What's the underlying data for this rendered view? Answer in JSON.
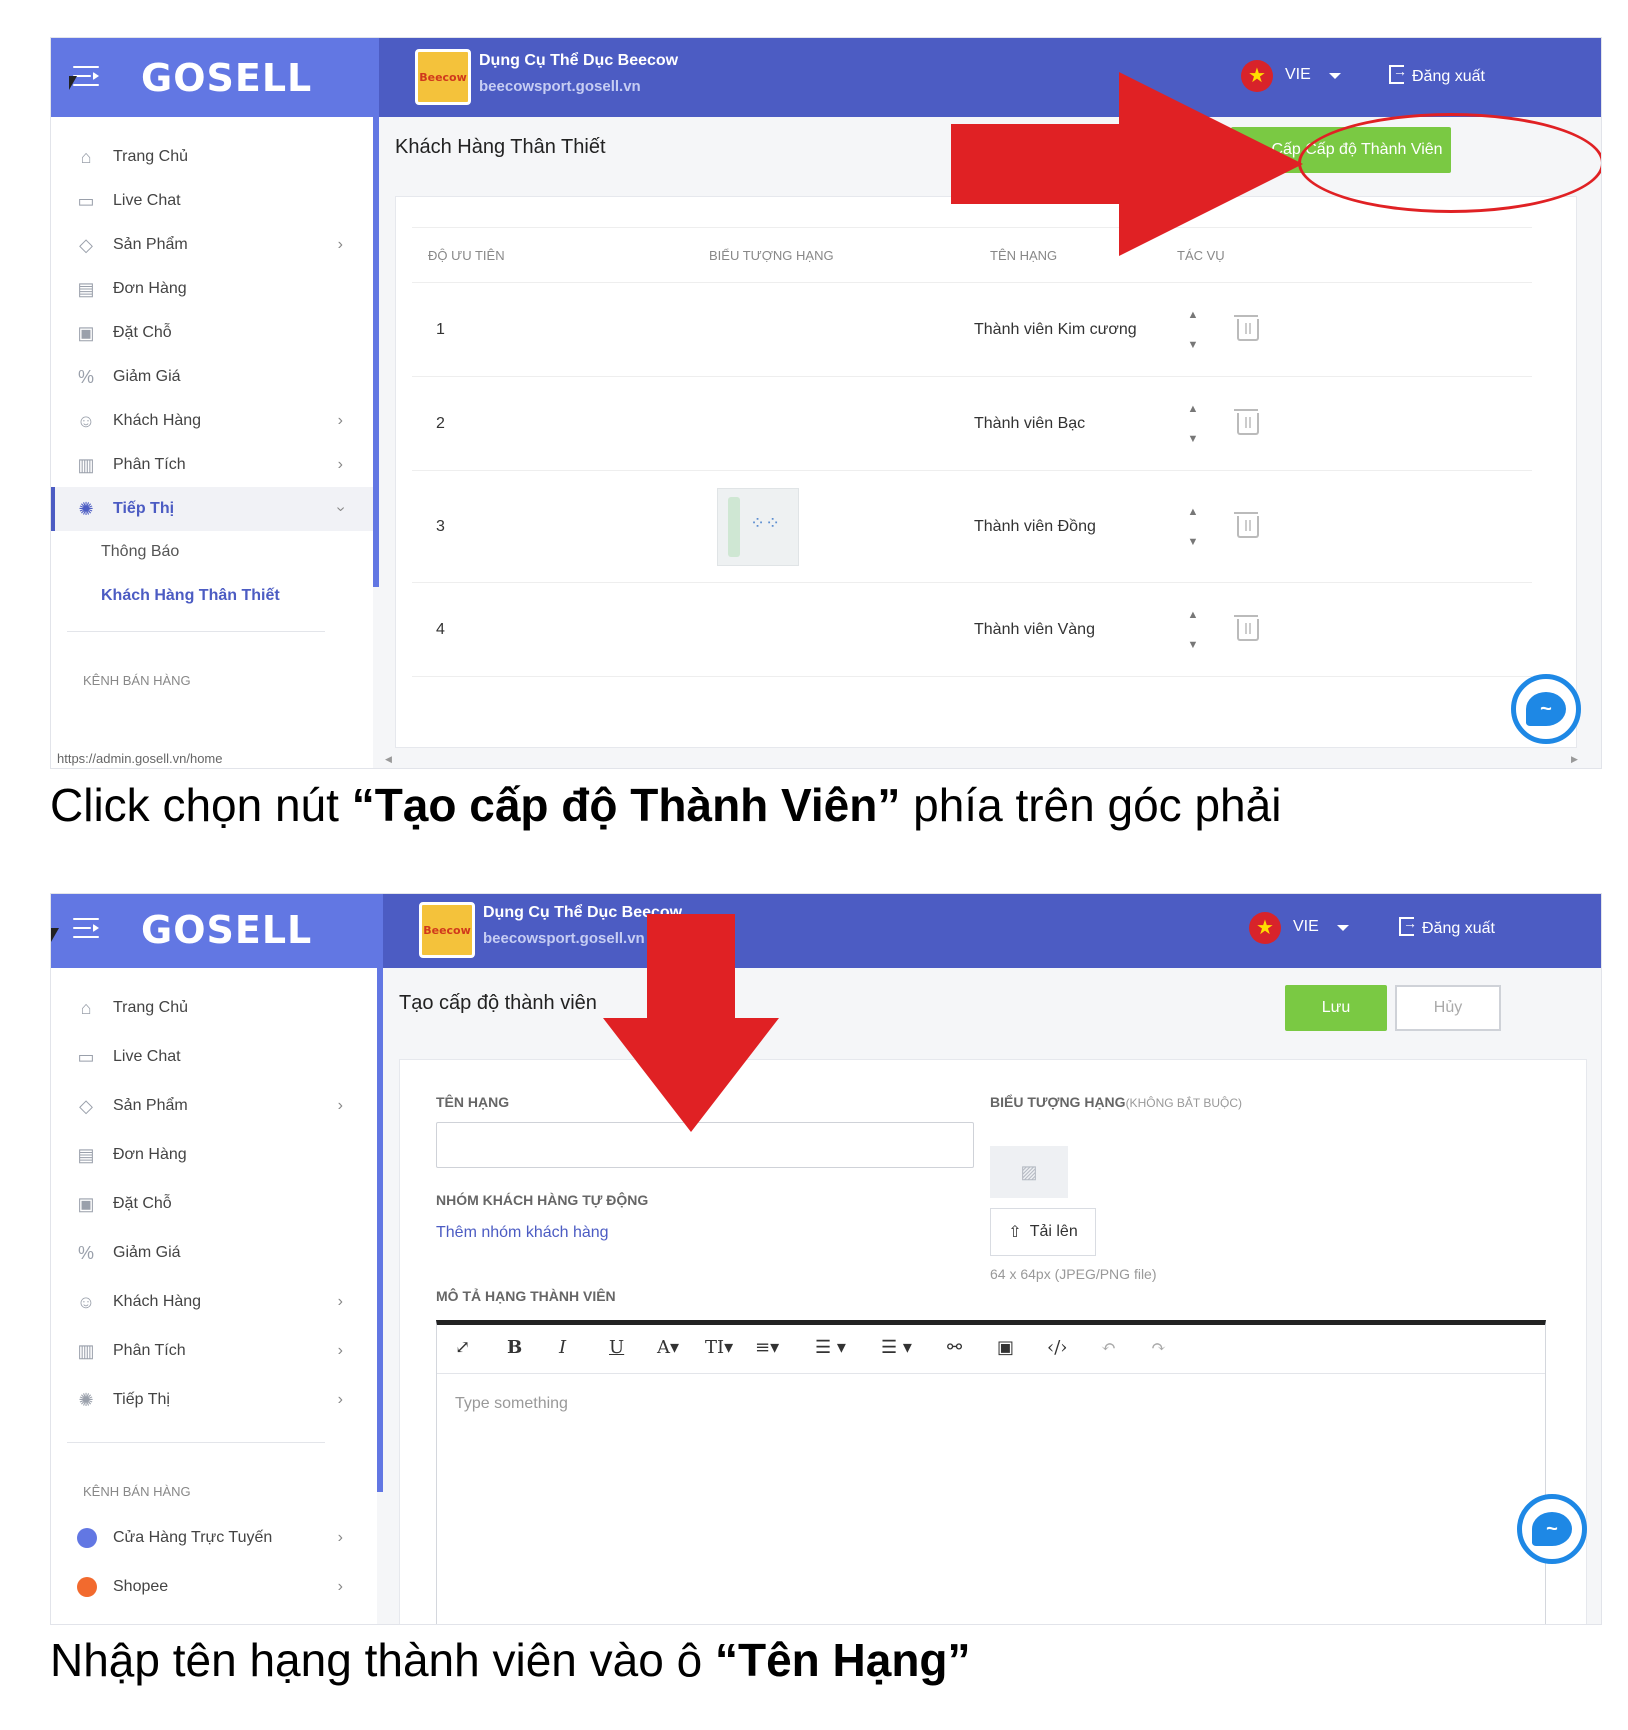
{
  "screens": [
    {
      "header": {
        "logo": "GOSELL",
        "store_logo_text": "Beecow",
        "store_name": "Dụng Cụ Thể Dục Beecow",
        "store_url": "beecowsport.gosell.vn",
        "language": "VIE",
        "logout": "Đăng xuất"
      },
      "sidebar": {
        "items": [
          {
            "label": "Trang Chủ"
          },
          {
            "label": "Live Chat"
          },
          {
            "label": "Sản Phẩm"
          },
          {
            "label": "Đơn Hàng"
          },
          {
            "label": "Đặt Chỗ"
          },
          {
            "label": "Giảm Giá"
          },
          {
            "label": "Khách Hàng"
          },
          {
            "label": "Phân Tích"
          },
          {
            "label": "Tiếp Thị"
          }
        ],
        "sub_items": [
          {
            "label": "Thông Báo"
          },
          {
            "label": "Khách Hàng Thân Thiết"
          }
        ],
        "channel_title": "KÊNH BÁN HÀNG",
        "status_url": "https://admin.gosell.vn/home"
      },
      "main": {
        "title": "Khách Hàng Thân Thiết",
        "create_button": "Tạo Cấp Cấp độ Thành Viên",
        "columns": [
          "ĐỘ ƯU TIÊN",
          "BIỂU TƯỢNG HẠNG",
          "TÊN HẠNG",
          "TÁC VỤ"
        ],
        "rows": [
          {
            "priority": "1",
            "name": "Thành viên Kim cương",
            "has_icon": false
          },
          {
            "priority": "2",
            "name": "Thành viên Bạc",
            "has_icon": false
          },
          {
            "priority": "3",
            "name": "Thành viên Đồng",
            "has_icon": true
          },
          {
            "priority": "4",
            "name": "Thành viên Vàng",
            "has_icon": false
          }
        ]
      },
      "caption": {
        "before": "Click chọn nút ",
        "bold": "“Tạo cấp độ Thành Viên”",
        "after": " phía trên góc phải"
      }
    },
    {
      "header": {
        "logo": "GOSELL",
        "store_logo_text": "Beecow",
        "store_name": "Dụng Cụ Thể Dục Beecow",
        "store_url": "beecowsport.gosell.vn",
        "language": "VIE",
        "logout": "Đăng xuất"
      },
      "sidebar": {
        "items": [
          {
            "label": "Trang Chủ"
          },
          {
            "label": "Live Chat"
          },
          {
            "label": "Sản Phẩm"
          },
          {
            "label": "Đơn Hàng"
          },
          {
            "label": "Đặt Chỗ"
          },
          {
            "label": "Giảm Giá"
          },
          {
            "label": "Khách Hàng"
          },
          {
            "label": "Phân Tích"
          },
          {
            "label": "Tiếp Thị"
          }
        ],
        "channel_title": "KÊNH BÁN HÀNG",
        "channels": [
          {
            "label": "Cửa Hàng Trực Tuyến"
          },
          {
            "label": "Shopee"
          }
        ]
      },
      "main": {
        "title": "Tạo cấp độ thành viên",
        "save_button": "Lưu",
        "cancel_button": "Hủy",
        "tier_name_label": "TÊN HẠNG",
        "tier_name_value": "",
        "tier_icon_label": "BIỂU TƯỢNG HẠNG",
        "tier_icon_optional": "(KHÔNG BẮT BUỘC)",
        "auto_group_label": "NHÓM KHÁCH HÀNG TỰ ĐỘNG",
        "add_group_link": "Thêm nhóm khách hàng",
        "upload_button": "Tải lên",
        "upload_hint": "64 x 64px (JPEG/PNG file)",
        "description_label": "MÔ TẢ HẠNG THÀNH VIÊN",
        "editor_placeholder": "Type something"
      },
      "caption": {
        "before": "Nhập tên hạng thành viên vào ô ",
        "bold": "“Tên Hạng”"
      }
    }
  ],
  "colors": {
    "brand_light": "#6277e3",
    "brand_dark": "#4c5cc3",
    "green": "#7ac943",
    "annotation_red": "#e02124",
    "messenger_blue": "#1e88e5"
  }
}
